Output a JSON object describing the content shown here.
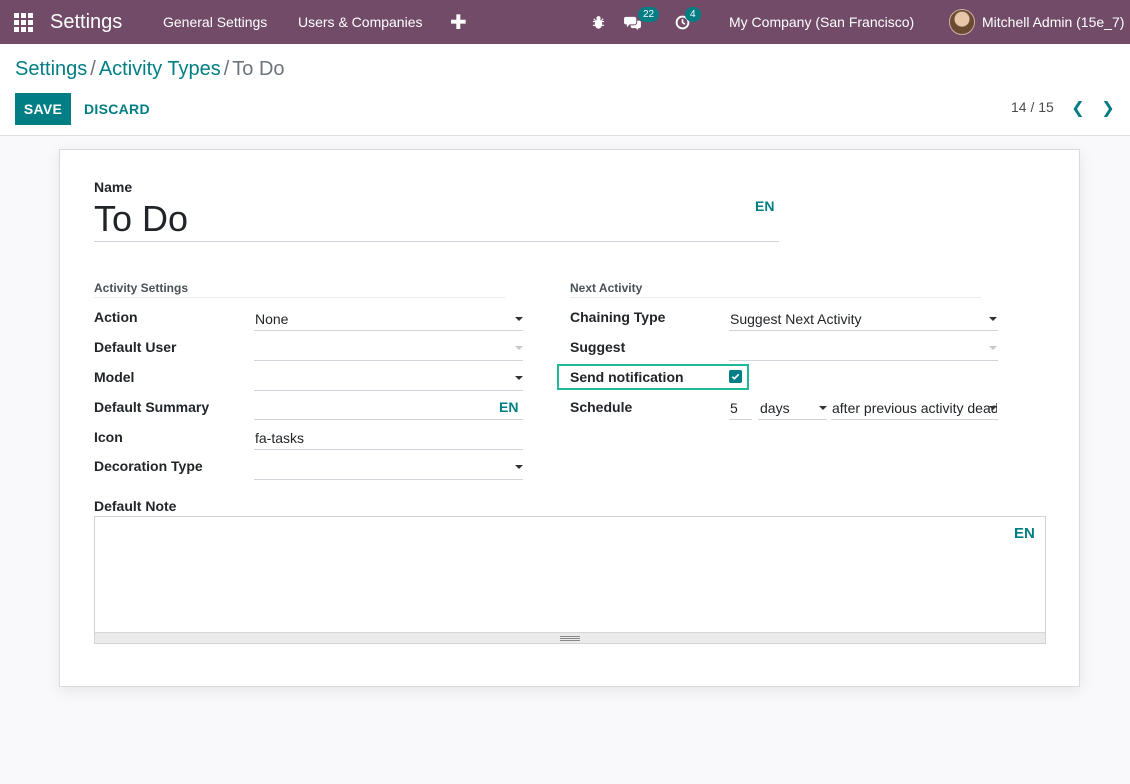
{
  "navbar": {
    "app_name": "Settings",
    "menu": [
      "General Settings",
      "Users & Companies"
    ],
    "plus_symbol": "✚",
    "messages_count": "22",
    "activities_count": "4",
    "company": "My Company (San Francisco)",
    "user": "Mitchell Admin (15e_7)",
    "bar_color": "#714b67"
  },
  "breadcrumb": {
    "items": [
      "Settings",
      "Activity Types"
    ],
    "separator": "/",
    "current": "To Do"
  },
  "actions": {
    "save_label": "SAVE",
    "discard_label": "DISCARD"
  },
  "pager": {
    "value": "14 / 15",
    "prev_glyph": "❮",
    "next_glyph": "❯"
  },
  "form": {
    "name_label": "Name",
    "name_value": "To Do",
    "lang_label": "EN",
    "activity_settings": {
      "title": "Activity Settings",
      "action_label": "Action",
      "action_value": "None",
      "default_user_label": "Default User",
      "default_user_value": "",
      "model_label": "Model",
      "model_value": "",
      "default_summary_label": "Default Summary",
      "default_summary_value": "",
      "icon_label": "Icon",
      "icon_value": "fa-tasks",
      "decoration_type_label": "Decoration Type",
      "decoration_type_value": ""
    },
    "next_activity": {
      "title": "Next Activity",
      "chaining_type_label": "Chaining Type",
      "chaining_type_value": "Suggest Next Activity",
      "suggest_label": "Suggest",
      "suggest_value": "",
      "send_notification_label": "Send notification",
      "send_notification_checked": true,
      "schedule_label": "Schedule",
      "schedule_count": "5",
      "schedule_unit": "days",
      "schedule_from": "after previous activity deadline"
    },
    "default_note_label": "Default Note"
  },
  "colors": {
    "accent": "#017e84",
    "brand": "#714b67",
    "highlight": "#21b799"
  }
}
